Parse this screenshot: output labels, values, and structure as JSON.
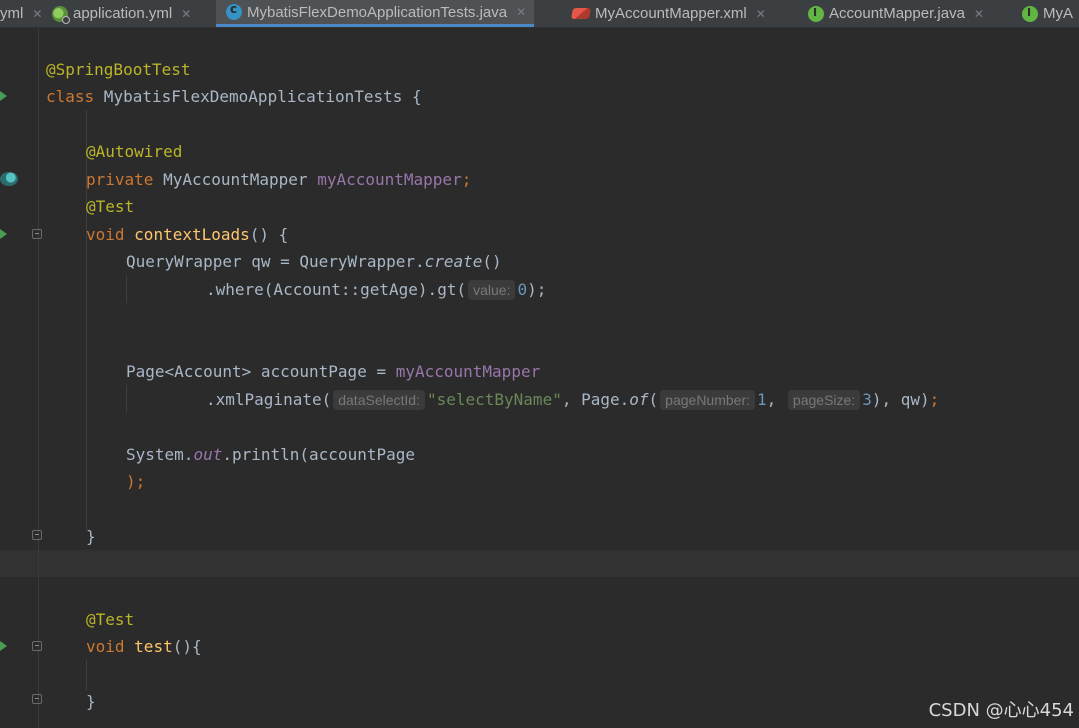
{
  "tabs": [
    {
      "label": "yml",
      "icon": "none",
      "active": false
    },
    {
      "label": "application.yml",
      "icon": "spring-config-icon",
      "active": false
    },
    {
      "label": "MybatisFlexDemoApplicationTests.java",
      "icon": "java-class-icon",
      "active": true
    },
    {
      "label": "MyAccountMapper.xml",
      "icon": "xml-mapper-icon",
      "active": false
    },
    {
      "label": "AccountMapper.java",
      "icon": "java-interface-icon",
      "active": false
    },
    {
      "label": "MyA",
      "icon": "java-interface-icon",
      "active": false
    }
  ],
  "code": {
    "l1": "@SpringBootTest",
    "l2_kw": "class",
    "l2_name": " MybatisFlexDemoApplicationTests {",
    "l4": "@Autowired",
    "l5_kw": "private",
    "l5_type": " MyAccountMapper ",
    "l5_field": "myAccountMapper",
    "l5_semi": ";",
    "l6": "@Test",
    "l7_kw": "void",
    "l7_fn": "contextLoads",
    "l7_rest": "() {",
    "l8_a": "QueryWrapper qw = QueryWrapper.",
    "l8_b": "create",
    "l8_c": "()",
    "l9_a": ".where(Account::getAge).gt(",
    "l9_hint": "value:",
    "l9_num": "0",
    "l9_end": ");",
    "l12_a": "Page<Account> accountPage = ",
    "l12_field": "myAccountMapper",
    "l13_a": ".xmlPaginate(",
    "l13_hint1": "dataSelectId:",
    "l13_str": "\"selectByName\"",
    "l13_b": ", Page.",
    "l13_of": "of",
    "l13_c": "(",
    "l13_hint2": "pageNumber:",
    "l13_num1": "1",
    "l13_d": ",",
    "l13_hint3": "pageSize:",
    "l13_num2": "3",
    "l13_e": "), qw)",
    "l13_semi": ";",
    "l15_a": "System.",
    "l15_out": "out",
    "l15_b": ".println(accountPage",
    "l16": ");",
    "l18": "}",
    "l21": "@Test",
    "l22_kw": "void",
    "l22_fn": "test",
    "l22_rest": "(){",
    "l24": "}"
  },
  "watermark": "CSDN @心心454"
}
